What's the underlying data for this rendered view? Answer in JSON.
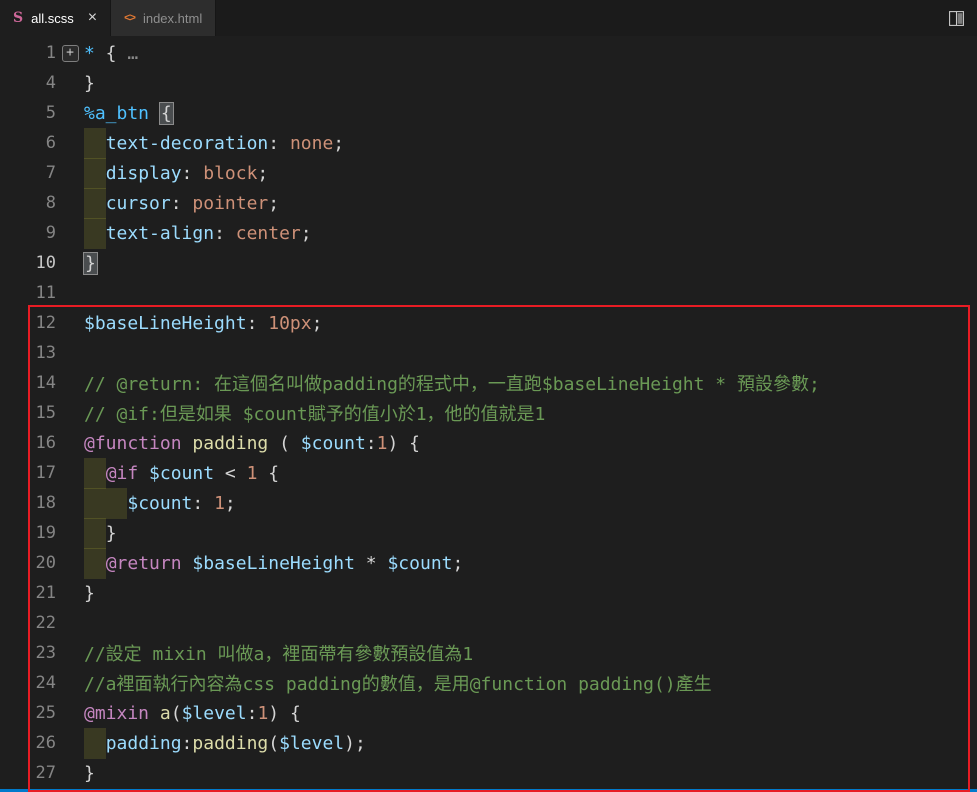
{
  "tab_bar": {
    "tabs": [
      {
        "label": "all.scss",
        "icon": "scss",
        "active": true,
        "has_close": true
      },
      {
        "label": "index.html",
        "icon": "html",
        "active": false,
        "has_close": false
      }
    ]
  },
  "icons": {
    "scss": "S",
    "html": "<>",
    "close": "×",
    "fold_plus": "+"
  },
  "colors": {
    "background": "#1e1e1e",
    "tab_bar": "#1b1b1b",
    "tab_inactive": "#2d2d2d",
    "tab_active": "#1e1e1e",
    "status_bar": "#007acc",
    "annotation_red": "#e81c24",
    "scss_icon": "#cd6799",
    "html_icon": "#e37933",
    "line_number": "#858585",
    "line_number_active": "#c6c6c6"
  },
  "token_colors": {
    "sel": "#4FC1FF",
    "prop": "#9CDCFE",
    "var": "#9CDCFE",
    "val": "#CE9178",
    "num": "#CE9178",
    "kw": "#C586C0",
    "fn": "#DCDCAA",
    "comment": "#6A9955",
    "punct": "#D4D4D4",
    "fold": "#8C8C8C",
    "bm": "#D4D4D4",
    "ind": ""
  },
  "editor": {
    "lines": [
      {
        "n": 1,
        "fold": true,
        "t": [
          [
            "sel",
            "*"
          ],
          [
            "punct",
            " {"
          ],
          [
            "fold",
            " …"
          ]
        ]
      },
      {
        "n": 4,
        "t": [
          [
            "punct",
            "}"
          ]
        ]
      },
      {
        "n": 5,
        "t": [
          [
            "sel",
            "%a_btn"
          ],
          [
            "punct",
            " "
          ],
          [
            "bm",
            "{"
          ]
        ]
      },
      {
        "n": 6,
        "t": [
          [
            "ind",
            "  "
          ],
          [
            "prop",
            "text-decoration"
          ],
          [
            "punct",
            ": "
          ],
          [
            "val",
            "none"
          ],
          [
            "punct",
            ";"
          ]
        ]
      },
      {
        "n": 7,
        "t": [
          [
            "ind",
            "  "
          ],
          [
            "prop",
            "display"
          ],
          [
            "punct",
            ": "
          ],
          [
            "val",
            "block"
          ],
          [
            "punct",
            ";"
          ]
        ]
      },
      {
        "n": 8,
        "t": [
          [
            "ind",
            "  "
          ],
          [
            "prop",
            "cursor"
          ],
          [
            "punct",
            ": "
          ],
          [
            "val",
            "pointer"
          ],
          [
            "punct",
            ";"
          ]
        ]
      },
      {
        "n": 9,
        "t": [
          [
            "ind",
            "  "
          ],
          [
            "prop",
            "text-align"
          ],
          [
            "punct",
            ": "
          ],
          [
            "val",
            "center"
          ],
          [
            "punct",
            ";"
          ]
        ]
      },
      {
        "n": 10,
        "active": true,
        "t": [
          [
            "bm",
            "}"
          ]
        ]
      },
      {
        "n": 11,
        "t": []
      },
      {
        "n": 12,
        "t": [
          [
            "var",
            "$baseLineHeight"
          ],
          [
            "punct",
            ": "
          ],
          [
            "num",
            "10px"
          ],
          [
            "punct",
            ";"
          ]
        ]
      },
      {
        "n": 13,
        "t": []
      },
      {
        "n": 14,
        "t": [
          [
            "comment",
            "// @return: 在這個名叫做padding的程式中，一直跑$baseLineHeight * 預設參數;"
          ]
        ]
      },
      {
        "n": 15,
        "t": [
          [
            "comment",
            "// @if:但是如果 $count賦予的值小於1，他的值就是1"
          ]
        ]
      },
      {
        "n": 16,
        "t": [
          [
            "kw",
            "@function"
          ],
          [
            "punct",
            " "
          ],
          [
            "fn",
            "padding"
          ],
          [
            "punct",
            " ( "
          ],
          [
            "var",
            "$count"
          ],
          [
            "punct",
            ":"
          ],
          [
            "num",
            "1"
          ],
          [
            "punct",
            ") {"
          ]
        ]
      },
      {
        "n": 17,
        "t": [
          [
            "ind",
            "  "
          ],
          [
            "kw",
            "@if"
          ],
          [
            "punct",
            " "
          ],
          [
            "var",
            "$count"
          ],
          [
            "punct",
            " < "
          ],
          [
            "num",
            "1"
          ],
          [
            "punct",
            " {"
          ]
        ]
      },
      {
        "n": 18,
        "t": [
          [
            "ind",
            "    "
          ],
          [
            "var",
            "$count"
          ],
          [
            "punct",
            ": "
          ],
          [
            "num",
            "1"
          ],
          [
            "punct",
            ";"
          ]
        ]
      },
      {
        "n": 19,
        "t": [
          [
            "ind",
            "  "
          ],
          [
            "punct",
            "}"
          ]
        ]
      },
      {
        "n": 20,
        "t": [
          [
            "ind",
            "  "
          ],
          [
            "kw",
            "@return"
          ],
          [
            "punct",
            " "
          ],
          [
            "var",
            "$baseLineHeight"
          ],
          [
            "punct",
            " * "
          ],
          [
            "var",
            "$count"
          ],
          [
            "punct",
            ";"
          ]
        ]
      },
      {
        "n": 21,
        "t": [
          [
            "punct",
            "}"
          ]
        ]
      },
      {
        "n": 22,
        "t": []
      },
      {
        "n": 23,
        "t": [
          [
            "comment",
            "//設定 mixin 叫做a，裡面帶有參數預設值為1"
          ]
        ]
      },
      {
        "n": 24,
        "t": [
          [
            "comment",
            "//a裡面執行內容為css padding的數值，是用@function padding()產生"
          ]
        ]
      },
      {
        "n": 25,
        "t": [
          [
            "kw",
            "@mixin"
          ],
          [
            "punct",
            " "
          ],
          [
            "fn",
            "a"
          ],
          [
            "punct",
            "("
          ],
          [
            "var",
            "$level"
          ],
          [
            "punct",
            ":"
          ],
          [
            "num",
            "1"
          ],
          [
            "punct",
            ") {"
          ]
        ]
      },
      {
        "n": 26,
        "t": [
          [
            "ind",
            "  "
          ],
          [
            "prop",
            "padding"
          ],
          [
            "punct",
            ":"
          ],
          [
            "fn",
            "padding"
          ],
          [
            "punct",
            "("
          ],
          [
            "var",
            "$level"
          ],
          [
            "punct",
            ");"
          ]
        ]
      },
      {
        "n": 27,
        "t": [
          [
            "punct",
            "}"
          ]
        ]
      }
    ]
  },
  "annotation": {
    "type": "red-box"
  }
}
